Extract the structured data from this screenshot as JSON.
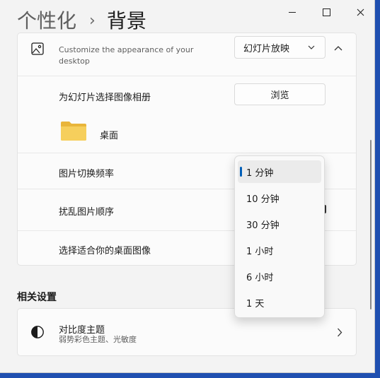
{
  "title": {
    "breadcrumb": "个性化",
    "current": "背景"
  },
  "background_card": {
    "description": "Customize the appearance of your desktop",
    "mode_value": "幻灯片放映",
    "album_label": "为幻灯片选择图像相册",
    "browse_label": "浏览",
    "folder_name": "桌面",
    "interval_label": "图片切换频率",
    "shuffle_label": "扰乱图片顺序",
    "fit_label": "选择适合你的桌面图像"
  },
  "related": {
    "title": "相关设置",
    "contrast_title": "对比度主题",
    "contrast_desc": "弱势彩色主题、光敏度"
  },
  "interval_dropdown": {
    "options": [
      "1 分钟",
      "10 分钟",
      "30 分钟",
      "1 小时",
      "6 小时",
      "1 天"
    ],
    "selected_index": 0
  },
  "colors": {
    "accent": "#005fb8",
    "folder": "#f2c94c"
  }
}
